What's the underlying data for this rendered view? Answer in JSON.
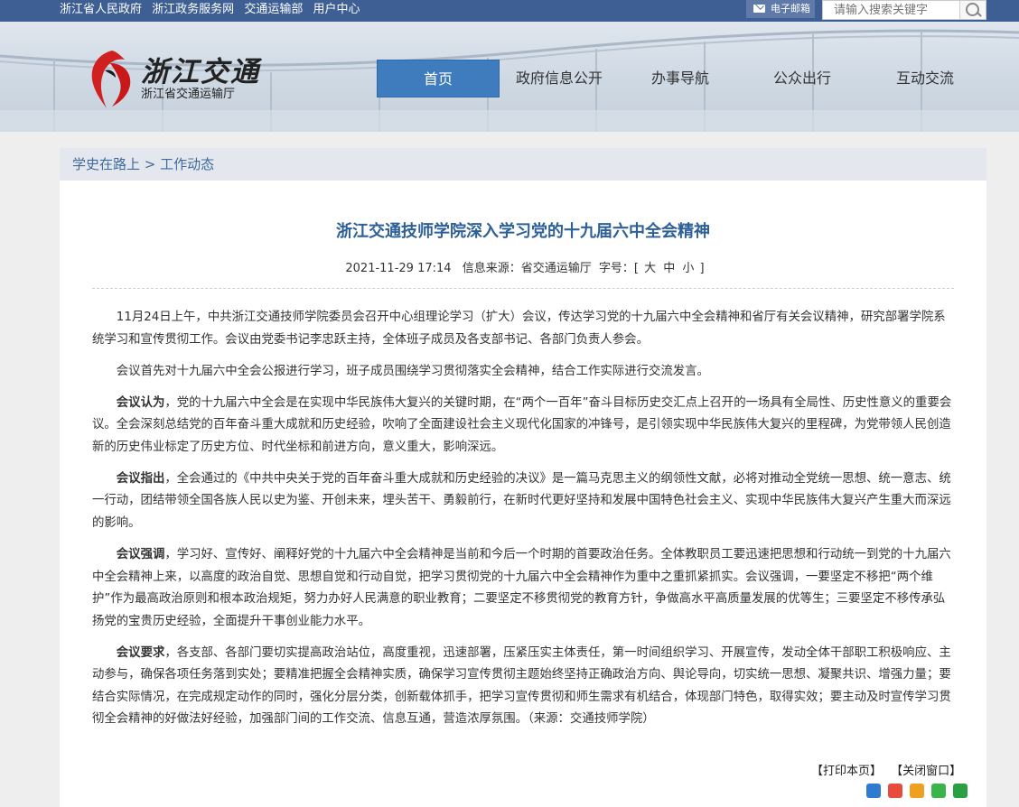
{
  "topbar": {
    "links": [
      "浙江省人民政府",
      "浙江政务服务网",
      "交通运输部",
      "用户中心"
    ],
    "email_label": "电子邮箱",
    "search_placeholder": "请输入搜索关键字"
  },
  "header": {
    "logo_title": "浙江交通",
    "logo_subtitle": "浙江省交通运输厅"
  },
  "nav": {
    "items": [
      {
        "label": "首页",
        "active": true
      },
      {
        "label": "政府信息公开"
      },
      {
        "label": "办事导航"
      },
      {
        "label": "公众出行"
      },
      {
        "label": "互动交流"
      }
    ]
  },
  "breadcrumb": {
    "section": "学史在路上",
    "separator": ">",
    "current": "工作动态"
  },
  "article": {
    "title": "浙江交通技师学院深入学习党的十九届六中全会精神",
    "datetime": "2021-11-29 17:14",
    "source": "信息来源：省交通运输厅",
    "font_label": "字号：[",
    "font_large": "大",
    "font_medium": "中",
    "font_small": "小",
    "font_close": "]",
    "paragraphs": [
      {
        "lead": "",
        "text": "11月24日上午，中共浙江交通技师学院委员会召开中心组理论学习（扩大）会议，传达学习党的十九届六中全会精神和省厅有关会议精神，研究部署学院系统学习和宣传贯彻工作。会议由党委书记李忠跃主持，全体班子成员及各支部书记、各部门负责人参会。"
      },
      {
        "lead": "",
        "text": "会议首先对十九届六中全会公报进行学习，班子成员围绕学习贯彻落实全会精神，结合工作实际进行交流发言。"
      },
      {
        "lead": "会议认为",
        "text": "，党的十九届六中全会是在实现中华民族伟大复兴的关键时期，在“两个一百年”奋斗目标历史交汇点上召开的一场具有全局性、历史性意义的重要会议。全会深刻总结党的百年奋斗重大成就和历史经验，吹响了全面建设社会主义现代化国家的冲锋号，是引领实现中华民族伟大复兴的里程碑，为党带领人民创造新的历史伟业标定了历史方位、时代坐标和前进方向，意义重大，影响深远。"
      },
      {
        "lead": "会议指出",
        "text": "，全会通过的《中共中央关于党的百年奋斗重大成就和历史经验的决议》是一篇马克思主义的纲领性文献，必将对推动全党统一思想、统一意志、统一行动，团结带领全国各族人民以史为鉴、开创未来，埋头苦干、勇毅前行，在新时代更好坚持和发展中国特色社会主义、实现中华民族伟大复兴产生重大而深远的影响。"
      },
      {
        "lead": "会议强调",
        "text": "，学习好、宣传好、阐释好党的十九届六中全会精神是当前和今后一个时期的首要政治任务。全体教职员工要迅速把思想和行动统一到党的十九届六中全会精神上来，以高度的政治自觉、思想自觉和行动自觉，把学习贯彻党的十九届六中全会精神作为重中之重抓紧抓实。会议强调，一要坚定不移把“两个维护”作为最高政治原则和根本政治规矩，努力办好人民满意的职业教育；二要坚定不移贯彻党的教育方针，争做高水平高质量发展的优等生；三要坚定不移传承弘扬党的宝贵历史经验，全面提升干事创业能力水平。"
      },
      {
        "lead": "会议要求",
        "text": "，各支部、各部门要切实提高政治站位，高度重视，迅速部署，压紧压实主体责任，第一时间组织学习、开展宣传，发动全体干部职工积极响应、主动参与，确保各项任务落到实处；要精准把握全会精神实质，确保学习宣传贯彻主题始终坚持正确政治方向、舆论导向，切实统一思想、凝聚共识、增强力量；要结合实际情况，在完成规定动作的同时，强化分层分类，创新载体抓手，把学习宣传贯彻和师生需求有机结合，体现部门特色，取得实效；要主动及时宣传学习贯彻全会精神的好做法好经验，加强部门间的工作交流、信息互通，营造浓厚氛围。（来源：交通技师学院）"
      }
    ]
  },
  "footer": {
    "print_label": "【打印本页】",
    "close_label": "【关闭窗口】"
  },
  "colors": {
    "topbar": "#3e5f93",
    "nav_active": "#3f7cbd",
    "title": "#2d5f98",
    "breadcrumb": "#3e6b9c"
  }
}
